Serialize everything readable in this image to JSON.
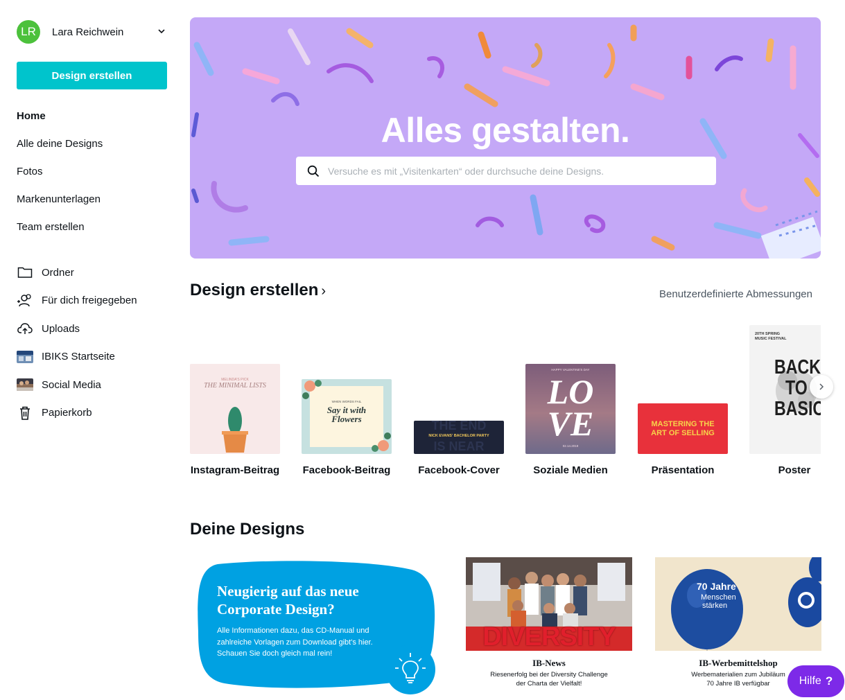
{
  "user": {
    "initials": "LR",
    "name": "Lara Reichwein",
    "avatar_color": "#4cc13c"
  },
  "sidebar": {
    "create_label": "Design erstellen",
    "nav": [
      {
        "label": "Home",
        "active": true
      },
      {
        "label": "Alle deine Designs"
      },
      {
        "label": "Fotos"
      },
      {
        "label": "Markenunterlagen"
      },
      {
        "label": "Team erstellen"
      }
    ],
    "nav2": [
      {
        "label": "Ordner",
        "icon": "folder-icon"
      },
      {
        "label": "Für dich freigegeben",
        "icon": "shared-users-icon"
      },
      {
        "label": "Uploads",
        "icon": "cloud-upload-icon"
      },
      {
        "label": "IBIKS Startseite",
        "icon": "team-thumbnail"
      },
      {
        "label": "Social Media",
        "icon": "team-thumbnail"
      },
      {
        "label": "Papierkorb",
        "icon": "trash-icon"
      }
    ]
  },
  "hero": {
    "title": "Alles gestalten.",
    "search_placeholder": "Versuche es mit „Visitenkarten“ oder durchsuche deine Designs.",
    "bg_color": "#c4a8f7"
  },
  "create_section": {
    "title": "Design erstellen",
    "custom_size_link": "Benutzerdefinierte Abmessungen",
    "cards": [
      {
        "label": "Instagram-Beitrag",
        "thumb": {
          "top": "MELINDA'S PICK",
          "title": "THE MINIMAL LISTS"
        }
      },
      {
        "label": "Facebook-Beitrag",
        "thumb": {
          "top": "WHEN WORDS FAIL",
          "title1": "Say it with",
          "title2": "Flowers"
        }
      },
      {
        "label": "Facebook-Cover",
        "thumb": {
          "line1": "NICK EVANS' BACHELOR PARTY",
          "bg1": "THE END",
          "bg2": "IS NEAR"
        }
      },
      {
        "label": "Soziale Medien",
        "thumb": {
          "top": "HAPPY VALENTINE'S DAY",
          "word1": "LO",
          "word2": "VE",
          "date": "02.14.2019"
        }
      },
      {
        "label": "Präsentation",
        "thumb": {
          "line1": "MASTERING THE",
          "line2": "ART OF SELLING"
        }
      },
      {
        "label": "Poster",
        "thumb": {
          "top1": "20TH SPRING",
          "top2": "MUSIC FESTIVAL",
          "w1": "BACK",
          "w2": "TO",
          "w3": "BASIC"
        }
      }
    ]
  },
  "designs_section": {
    "title": "Deine Designs",
    "bubble": {
      "title": "Neugierig auf das neue Corporate Design?",
      "text": "Alle Informationen dazu, das CD-Manual und zahlreiche Vorlagen zum Download gibt's hier. Schauen Sie doch gleich mal rein!"
    },
    "news": [
      {
        "title": "IB-News",
        "line1": "Riesenerfolg bei der Diversity Challenge",
        "line2": "der Charta der Vielfalt!",
        "banner": "DIVERSITY"
      },
      {
        "title": "IB-Werbemittelshop",
        "line1": "Werbematerialien zum Jubiläum",
        "line2": "70 Jahre IB verfügbar",
        "balloon1": "70 Jahre",
        "balloon2": "Menschen",
        "balloon3": "stärken"
      }
    ]
  },
  "help": {
    "label": "Hilfe",
    "mark": "?"
  }
}
